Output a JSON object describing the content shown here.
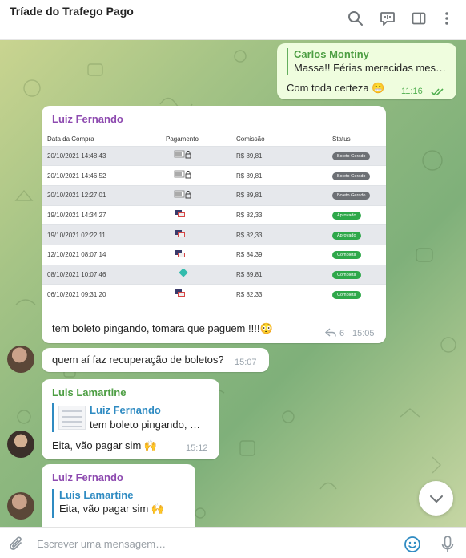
{
  "header": {
    "title": "Tríade do Trafego Pago",
    "icons": [
      "search-icon",
      "chat-icon",
      "sidebar-icon",
      "more-icon"
    ]
  },
  "colors": {
    "accent": "#64ad5e",
    "sender_purple": "#8e4bb0",
    "sender_green": "#4d9e43",
    "reply_blue": "#2f8bc2",
    "check_green": "#4fae4e"
  },
  "messages": [
    {
      "type": "outgoing",
      "reply_name": "Carlos Montiny",
      "reply_text": "Massa!! Férias merecidas mes…",
      "text": "Com  toda certeza 😬",
      "time": "11:16"
    },
    {
      "type": "incoming",
      "sender": "Luiz Fernando",
      "image_table": {
        "headers": [
          "Data da Compra",
          "Pagamento",
          "Comissão",
          "Status"
        ],
        "rows": [
          {
            "date": "20/10/2021 14:48:43",
            "payment": "boleto-icon",
            "commission": "R$ 89,81",
            "status": "Boleto Gerado"
          },
          {
            "date": "20/10/2021 14:46:52",
            "payment": "boleto-icon",
            "commission": "R$ 89,81",
            "status": "Boleto Gerado"
          },
          {
            "date": "20/10/2021 12:27:01",
            "payment": "boleto-icon",
            "commission": "R$ 89,81",
            "status": "Boleto Gerado"
          },
          {
            "date": "19/10/2021 14:34:27",
            "payment": "card-icon",
            "commission": "R$ 82,33",
            "status": "Aprovado"
          },
          {
            "date": "19/10/2021 02:22:11",
            "payment": "card-icon",
            "commission": "R$ 82,33",
            "status": "Aprovado"
          },
          {
            "date": "12/10/2021 08:07:14",
            "payment": "card-icon",
            "commission": "R$ 84,39",
            "status": "Completa"
          },
          {
            "date": "08/10/2021 10:07:46",
            "payment": "pix-icon",
            "commission": "R$ 89,81",
            "status": "Completa"
          },
          {
            "date": "06/10/2021 09:31:20",
            "payment": "card-icon",
            "commission": "R$ 82,33",
            "status": "Completa"
          }
        ]
      },
      "text": "tem boleto pingando, tomara que paguem !!!!😳",
      "replies": "6",
      "time": "15:05"
    },
    {
      "type": "incoming",
      "text": "quem aí faz recuperação de boletos?",
      "time": "15:07"
    },
    {
      "type": "incoming",
      "sender": "Luis Lamartine",
      "reply_name": "Luiz Fernando",
      "reply_text": "tem boleto pingando, …",
      "text": "Eita, vão pagar sim 🙌",
      "time": "15:12"
    },
    {
      "type": "incoming",
      "sender": "Luiz Fernando",
      "reply_name": "Luis Lamartine",
      "reply_text": "Eita, vão pagar sim 🙌"
    }
  ],
  "composer": {
    "placeholder": "Escrever uma mensagem…"
  }
}
